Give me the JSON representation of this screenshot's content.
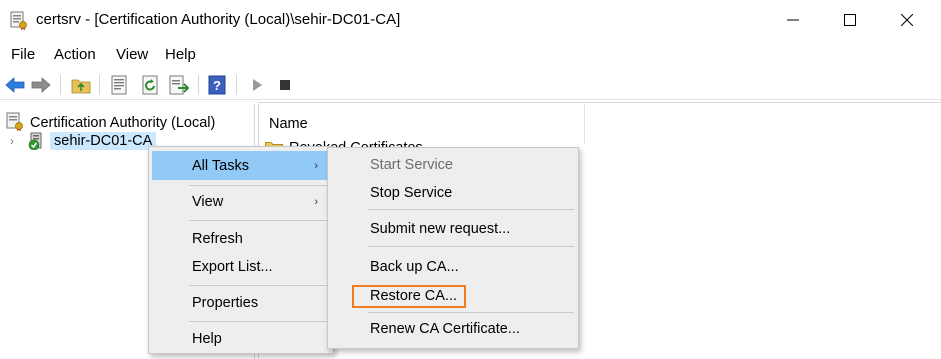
{
  "window": {
    "title": "certsrv - [Certification Authority (Local)\\sehir-DC01-CA]",
    "icons": {
      "app": "certsrv-icon",
      "minimize": "minimize-icon",
      "maximize": "maximize-icon",
      "close": "close-icon"
    }
  },
  "menubar": {
    "items": [
      "File",
      "Action",
      "View",
      "Help"
    ]
  },
  "toolbar": {
    "buttons": [
      "back-icon",
      "forward-icon",
      "up-folder-icon",
      "properties-icon",
      "refresh-icon",
      "export-icon",
      "help-icon",
      "start-icon",
      "stop-icon"
    ]
  },
  "tree": {
    "root_label": "Certification Authority (Local)",
    "child_label": "sehir-DC01-CA"
  },
  "list": {
    "column_header": "Name",
    "rows": [
      "Revoked Certificates"
    ]
  },
  "context_menu": {
    "items": [
      {
        "label": "All Tasks",
        "submenu": true,
        "highlighted": true
      },
      {
        "label": "View",
        "submenu": true
      },
      {
        "label": "Refresh"
      },
      {
        "label": "Export List..."
      },
      {
        "label": "Properties"
      },
      {
        "label": "Help"
      }
    ]
  },
  "all_tasks_submenu": {
    "items": [
      {
        "label": "Start Service",
        "disabled": true
      },
      {
        "label": "Stop Service"
      },
      {
        "label": "Submit new request..."
      },
      {
        "label": "Back up CA..."
      },
      {
        "label": "Restore CA...",
        "annotated": true
      },
      {
        "label": "Renew CA Certificate..."
      }
    ],
    "annotation_color": "#ef7d22"
  },
  "colors": {
    "highlight": "#91c9f7",
    "selection": "#cce8ff",
    "annotation": "#ef7d22"
  }
}
